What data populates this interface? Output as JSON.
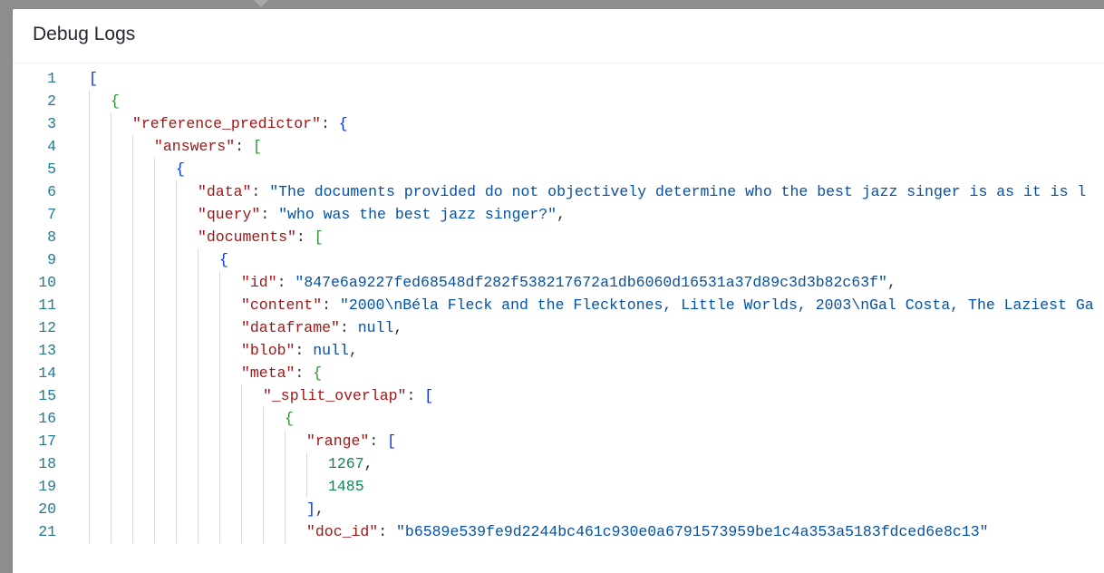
{
  "header": {
    "title": "Debug Logs"
  },
  "lines": [
    {
      "num": 1,
      "indent": 0,
      "segments": [
        {
          "cls": "sp-brace",
          "t": "["
        }
      ]
    },
    {
      "num": 2,
      "indent": 1,
      "segments": [
        {
          "cls": "sp-brace2",
          "t": "{"
        }
      ]
    },
    {
      "num": 3,
      "indent": 2,
      "segments": [
        {
          "cls": "sp-key",
          "t": "\"reference_predictor\""
        },
        {
          "cls": "sp-punc",
          "t": ": "
        },
        {
          "cls": "sp-brace",
          "t": "{"
        }
      ]
    },
    {
      "num": 4,
      "indent": 3,
      "segments": [
        {
          "cls": "sp-key",
          "t": "\"answers\""
        },
        {
          "cls": "sp-punc",
          "t": ": "
        },
        {
          "cls": "sp-brace2",
          "t": "["
        }
      ]
    },
    {
      "num": 5,
      "indent": 4,
      "segments": [
        {
          "cls": "sp-brace",
          "t": "{"
        }
      ]
    },
    {
      "num": 6,
      "indent": 5,
      "segments": [
        {
          "cls": "sp-key",
          "t": "\"data\""
        },
        {
          "cls": "sp-punc",
          "t": ": "
        },
        {
          "cls": "sp-str",
          "t": "\"The documents provided do not objectively determine who the best jazz singer is as it is l"
        }
      ]
    },
    {
      "num": 7,
      "indent": 5,
      "segments": [
        {
          "cls": "sp-key",
          "t": "\"query\""
        },
        {
          "cls": "sp-punc",
          "t": ": "
        },
        {
          "cls": "sp-str",
          "t": "\"who was the best jazz singer?\""
        },
        {
          "cls": "sp-punc",
          "t": ","
        }
      ]
    },
    {
      "num": 8,
      "indent": 5,
      "segments": [
        {
          "cls": "sp-key",
          "t": "\"documents\""
        },
        {
          "cls": "sp-punc",
          "t": ": "
        },
        {
          "cls": "sp-brace2",
          "t": "["
        }
      ]
    },
    {
      "num": 9,
      "indent": 6,
      "segments": [
        {
          "cls": "sp-brace",
          "t": "{"
        }
      ]
    },
    {
      "num": 10,
      "indent": 7,
      "segments": [
        {
          "cls": "sp-key",
          "t": "\"id\""
        },
        {
          "cls": "sp-punc",
          "t": ": "
        },
        {
          "cls": "sp-str",
          "t": "\"847e6a9227fed68548df282f538217672a1db6060d16531a37d89c3d3b82c63f\""
        },
        {
          "cls": "sp-punc",
          "t": ","
        }
      ]
    },
    {
      "num": 11,
      "indent": 7,
      "segments": [
        {
          "cls": "sp-key",
          "t": "\"content\""
        },
        {
          "cls": "sp-punc",
          "t": ": "
        },
        {
          "cls": "sp-str",
          "t": "\"2000\\nBéla Fleck and the Flecktones, Little Worlds, 2003\\nGal Costa, The Laziest Ga"
        }
      ]
    },
    {
      "num": 12,
      "indent": 7,
      "segments": [
        {
          "cls": "sp-key",
          "t": "\"dataframe\""
        },
        {
          "cls": "sp-punc",
          "t": ": "
        },
        {
          "cls": "sp-null",
          "t": "null"
        },
        {
          "cls": "sp-punc",
          "t": ","
        }
      ]
    },
    {
      "num": 13,
      "indent": 7,
      "segments": [
        {
          "cls": "sp-key",
          "t": "\"blob\""
        },
        {
          "cls": "sp-punc",
          "t": ": "
        },
        {
          "cls": "sp-null",
          "t": "null"
        },
        {
          "cls": "sp-punc",
          "t": ","
        }
      ]
    },
    {
      "num": 14,
      "indent": 7,
      "segments": [
        {
          "cls": "sp-key",
          "t": "\"meta\""
        },
        {
          "cls": "sp-punc",
          "t": ": "
        },
        {
          "cls": "sp-brace2",
          "t": "{"
        }
      ]
    },
    {
      "num": 15,
      "indent": 8,
      "segments": [
        {
          "cls": "sp-key",
          "t": "\"_split_overlap\""
        },
        {
          "cls": "sp-punc",
          "t": ": "
        },
        {
          "cls": "sp-brace",
          "t": "["
        }
      ]
    },
    {
      "num": 16,
      "indent": 9,
      "segments": [
        {
          "cls": "sp-brace2",
          "t": "{"
        }
      ]
    },
    {
      "num": 17,
      "indent": 10,
      "segments": [
        {
          "cls": "sp-key",
          "t": "\"range\""
        },
        {
          "cls": "sp-punc",
          "t": ": "
        },
        {
          "cls": "sp-brace",
          "t": "["
        }
      ]
    },
    {
      "num": 18,
      "indent": 11,
      "segments": [
        {
          "cls": "sp-num",
          "t": "1267"
        },
        {
          "cls": "sp-punc",
          "t": ","
        }
      ]
    },
    {
      "num": 19,
      "indent": 11,
      "segments": [
        {
          "cls": "sp-num",
          "t": "1485"
        }
      ]
    },
    {
      "num": 20,
      "indent": 10,
      "segments": [
        {
          "cls": "sp-brace",
          "t": "]"
        },
        {
          "cls": "sp-punc",
          "t": ","
        }
      ]
    },
    {
      "num": 21,
      "indent": 10,
      "segments": [
        {
          "cls": "sp-key",
          "t": "\"doc_id\""
        },
        {
          "cls": "sp-punc",
          "t": ": "
        },
        {
          "cls": "sp-str",
          "t": "\"b6589e539fe9d2244bc461c930e0a6791573959be1c4a353a5183fdced6e8c13\""
        }
      ]
    }
  ]
}
